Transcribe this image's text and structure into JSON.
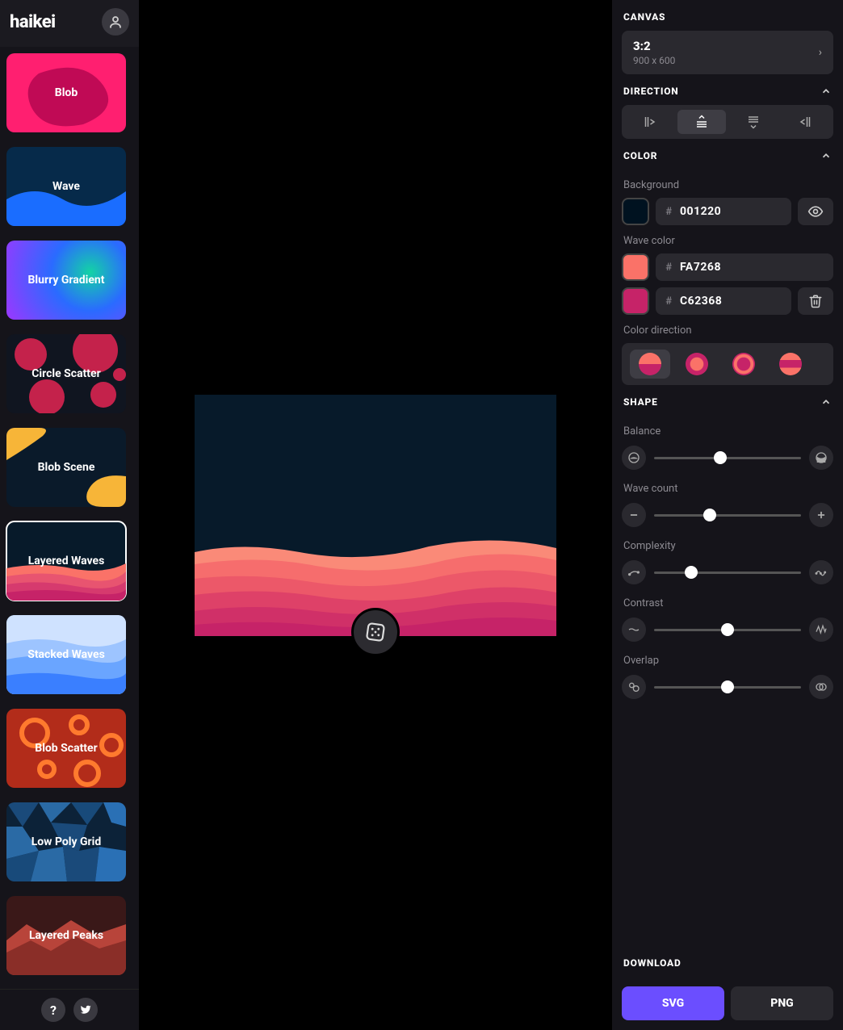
{
  "logo": "haikei",
  "generators": [
    {
      "label": "Blob"
    },
    {
      "label": "Wave"
    },
    {
      "label": "Blurry Gradient"
    },
    {
      "label": "Circle Scatter"
    },
    {
      "label": "Blob Scene"
    },
    {
      "label": "Layered Waves",
      "selected": true
    },
    {
      "label": "Stacked Waves"
    },
    {
      "label": "Blob Scatter"
    },
    {
      "label": "Low Poly Grid"
    },
    {
      "label": "Layered Peaks"
    }
  ],
  "panel": {
    "canvas": {
      "title": "CANVAS",
      "ratio": "3:2",
      "dims": "900 x 600"
    },
    "direction": {
      "title": "DIRECTION",
      "selected": 1
    },
    "color": {
      "title": "COLOR",
      "bg_label": "Background",
      "bg_hex": "001220",
      "wave_label": "Wave color",
      "wave_hex1": "FA7268",
      "wave_hex2": "C62368",
      "colordir_label": "Color direction",
      "colordir_selected": 0
    },
    "shape": {
      "title": "SHAPE",
      "sliders": [
        {
          "label": "Balance",
          "pct": 45
        },
        {
          "label": "Wave count",
          "pct": 38
        },
        {
          "label": "Complexity",
          "pct": 25
        },
        {
          "label": "Contrast",
          "pct": 50
        },
        {
          "label": "Overlap",
          "pct": 50
        }
      ]
    },
    "download": {
      "title": "DOWNLOAD",
      "svg": "SVG",
      "png": "PNG"
    }
  },
  "colors": {
    "bg": "#001220",
    "wave1": "#FA7268",
    "wave2": "#C62368"
  }
}
